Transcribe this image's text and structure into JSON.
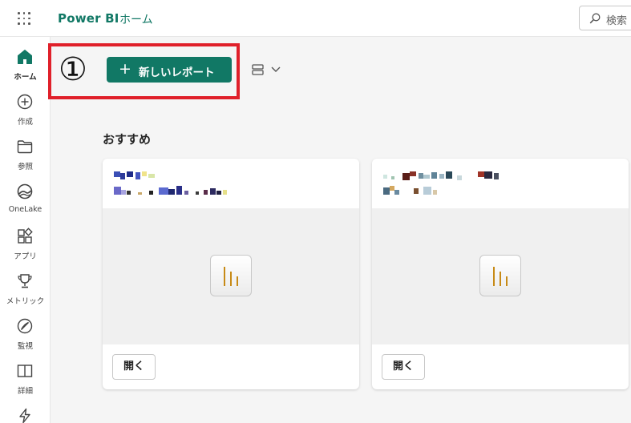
{
  "header": {
    "app_name": "Power BI",
    "breadcrumb": "ホーム",
    "search_placeholder": "検索"
  },
  "sidebar": {
    "items": [
      {
        "label": "ホーム",
        "icon": "home-icon",
        "active": true
      },
      {
        "label": "作成",
        "icon": "create-icon"
      },
      {
        "label": "参照",
        "icon": "browse-icon"
      },
      {
        "label": "OneLake",
        "icon": "onelake-icon"
      },
      {
        "label": "アプリ",
        "icon": "apps-icon"
      },
      {
        "label": "メトリック",
        "icon": "metrics-icon"
      },
      {
        "label": "監視",
        "icon": "monitor-icon"
      },
      {
        "label": "詳細",
        "icon": "learn-icon"
      },
      {
        "label": "",
        "icon": "workloads-icon"
      }
    ]
  },
  "annotation": {
    "step_marker": "①",
    "highlight_color": "#e0202a"
  },
  "actions": {
    "new_report_label": "新しいレポート",
    "new_report_icon": "plus-icon"
  },
  "recommended": {
    "title": "おすすめ",
    "cards": [
      {
        "open_label": "開く",
        "thumbnail_icon": "report-chart-icon",
        "title_obscured": true
      },
      {
        "open_label": "開く",
        "thumbnail_icon": "report-chart-icon",
        "title_obscured": true
      }
    ]
  },
  "colors": {
    "accent": "#117865",
    "page_background": "#f5f5f5"
  }
}
